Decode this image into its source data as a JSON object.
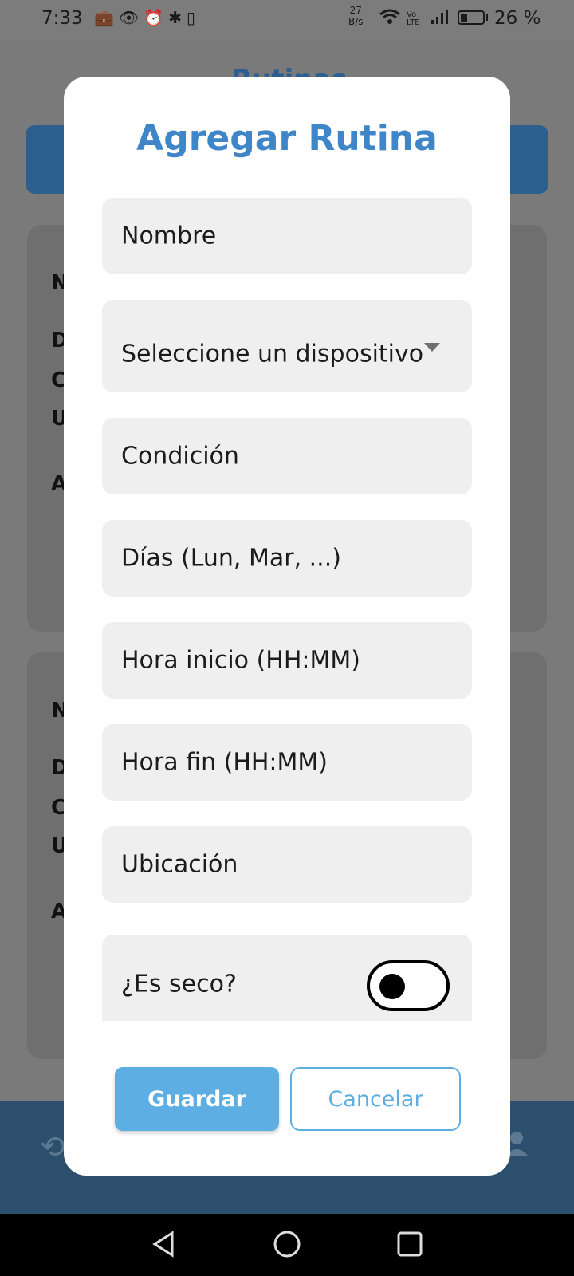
{
  "status_bar": {
    "time": "7:33",
    "net_speed_value": "27",
    "net_speed_unit": "B/s",
    "volte_label": "Vo\nLTE",
    "battery_pct": "26 %",
    "battery_level": 0.26
  },
  "background_app": {
    "title_partial": "Rutinas",
    "card_labels_1": [
      "N",
      "D",
      "C",
      "U",
      "A"
    ],
    "card_labels_2": [
      "N",
      "D",
      "C",
      "U",
      "A"
    ]
  },
  "dialog": {
    "title": "Agregar Rutina",
    "fields": {
      "nombre": "Nombre",
      "dispositivo": "Seleccione un dispositivo",
      "condicion": "Condición",
      "dias": "Días (Lun, Mar, ...)",
      "hora_inicio": "Hora inicio (HH:MM)",
      "hora_fin": "Hora fin (HH:MM)",
      "ubicacion": "Ubicación",
      "es_seco": "¿Es seco?"
    },
    "es_seco_value": false,
    "save_label": "Guardar",
    "cancel_label": "Cancelar"
  },
  "colors": {
    "accent": "#3f86c8",
    "save_button": "#5daee3",
    "field_bg": "#efefef"
  }
}
